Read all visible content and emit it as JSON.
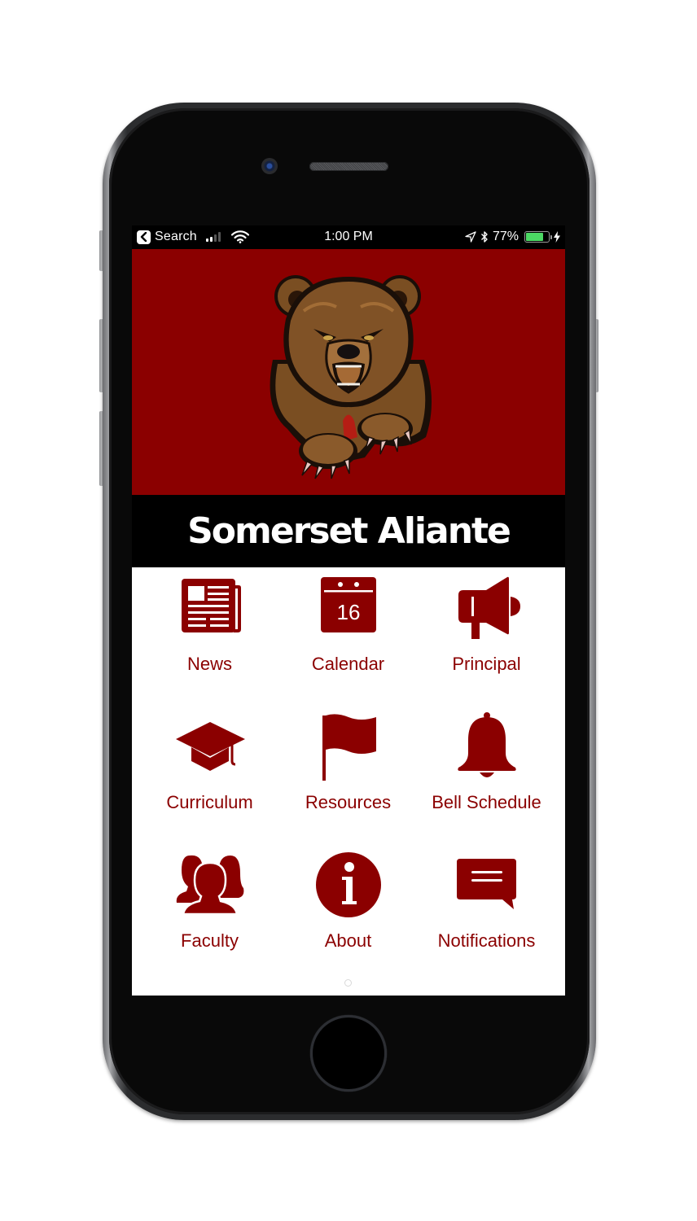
{
  "status_bar": {
    "back_label": "Search",
    "time": "1:00 PM",
    "battery_percent": "77%",
    "battery_level": 0.77,
    "signal_bars_active": 2,
    "signal_bars_total": 4,
    "icons": [
      "back-arrow-icon",
      "signal-icon",
      "wifi-icon",
      "location-arrow-icon",
      "bluetooth-icon",
      "battery-icon",
      "charging-bolt-icon"
    ]
  },
  "header": {
    "mascot_image": "bear-mascot",
    "title": "Somerset Aliante"
  },
  "theme": {
    "brand_red": "#8b0000",
    "title_band": "#000000",
    "battery_green": "#4cd964"
  },
  "menu": {
    "items": [
      {
        "label": "News",
        "icon": "newspaper-icon"
      },
      {
        "label": "Calendar",
        "icon": "calendar-icon",
        "icon_text": "16"
      },
      {
        "label": "Principal",
        "icon": "megaphone-icon"
      },
      {
        "label": "Curriculum",
        "icon": "graduation-cap-icon"
      },
      {
        "label": "Resources",
        "icon": "flag-icon"
      },
      {
        "label": "Bell Schedule",
        "icon": "bell-icon"
      },
      {
        "label": "Faculty",
        "icon": "people-group-icon"
      },
      {
        "label": "About",
        "icon": "info-icon"
      },
      {
        "label": "Notifications",
        "icon": "message-icon"
      }
    ]
  },
  "pagination": {
    "current_page": 1,
    "total_pages": 1
  }
}
